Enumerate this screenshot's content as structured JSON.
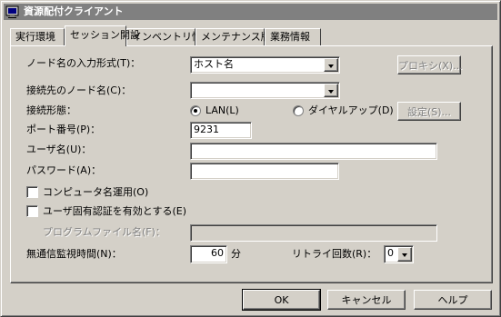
{
  "window": {
    "title": "資源配付クライアント"
  },
  "tabs": [
    {
      "label": "実行環境",
      "active": false
    },
    {
      "label": "セッション開設",
      "active": true
    },
    {
      "label": "インベントリ情報",
      "active": false
    },
    {
      "label": "メンテナンス版数",
      "active": false
    },
    {
      "label": "業務情報",
      "active": false
    }
  ],
  "form": {
    "node_input_label": "ノード名の入力形式(T)：",
    "node_input_value": "ホスト名",
    "proxy_button": "プロキシ(X)...",
    "dest_node_label": "接続先のノード名(C)：",
    "dest_node_value": "",
    "conn_type_label": "接続形態：",
    "radio_lan": "LAN(L)",
    "radio_dialup": "ダイヤルアップ(D)",
    "settings_button": "設定(S)...",
    "port_label": "ポート番号(P)：",
    "port_value": "9231",
    "user_label": "ユーザ名(U)：",
    "user_value": "",
    "password_label": "パスワード(A)：",
    "password_value": "",
    "computer_name_label": "コンピュータ名運用(O)",
    "user_auth_label": "ユーザ固有認証を有効とする(E)",
    "program_file_label": "プログラムファイル名(F)：",
    "program_file_value": "",
    "no_comm_label": "無通信監視時間(N)：",
    "no_comm_value": "60",
    "no_comm_unit": "分",
    "retry_label": "リトライ回数(R)：",
    "retry_value": "0"
  },
  "buttons": {
    "ok": "OK",
    "cancel": "キャンセル",
    "help": "ヘルプ"
  }
}
